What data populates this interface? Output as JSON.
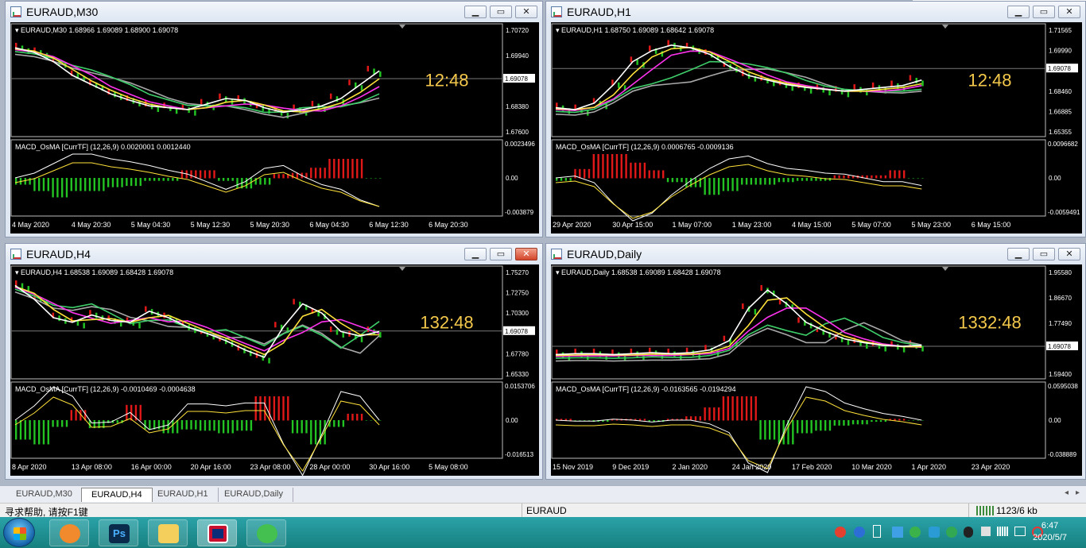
{
  "windows": [
    {
      "id": "w1",
      "title": "EURAUD,M30",
      "close_red": false,
      "info": "EURAUD,M30  1.68966 1.69089 1.68900 1.69078",
      "price_labels": [
        "1.70720",
        "1.69940",
        "1.69078",
        "1.68380",
        "1.67600"
      ],
      "price_marker": "1.69078",
      "timer": "12:48",
      "macd_label": "MACD_OsMA [CurrTF] (12,26,9) 0.0020001 0.0012440",
      "macd_labels": [
        "0.0023496",
        "0.00",
        "-0.003879"
      ],
      "time_labels": [
        "4 May 2020",
        "4 May 20:30",
        "5 May 04:30",
        "5 May 12:30",
        "5 May 20:30",
        "6 May 04:30",
        "6 May 12:30",
        "6 May 20:30"
      ]
    },
    {
      "id": "w2",
      "title": "EURAUD,H1",
      "close_red": false,
      "info": "EURAUD,H1  1.68750 1.69089 1.68642 1.69078",
      "price_labels": [
        "1.71565",
        "1.69990",
        "1.69078",
        "1.68460",
        "1.66885",
        "1.65355"
      ],
      "price_marker": "1.69078",
      "timer": "12:48",
      "macd_label": "MACD_OsMA [CurrTF] (12,26,9) 0.0006765 -0.0009136",
      "macd_labels": [
        "0.0096682",
        "0.00",
        "-0.0059491"
      ],
      "time_labels": [
        "29 Apr 2020",
        "30 Apr 15:00",
        "1 May 07:00",
        "1 May 23:00",
        "4 May 15:00",
        "5 May 07:00",
        "5 May 23:00",
        "6 May 15:00"
      ]
    },
    {
      "id": "w3",
      "title": "EURAUD,H4",
      "close_red": true,
      "info": "EURAUD,H4  1.68538 1.69089 1.68428 1.69078",
      "price_labels": [
        "1.75270",
        "1.72750",
        "1.70300",
        "1.69078",
        "1.67780",
        "1.65330"
      ],
      "price_marker": "1.69078",
      "timer": "132:48",
      "macd_label": "MACD_OsMA [CurrTF] (12,26,9) -0.0010469 -0.0004638",
      "macd_labels": [
        "0.0153706",
        "0.00",
        "-0.016513"
      ],
      "time_labels": [
        "8 Apr 2020",
        "13 Apr 08:00",
        "16 Apr 00:00",
        "20 Apr 16:00",
        "23 Apr 08:00",
        "28 Apr 00:00",
        "30 Apr 16:00",
        "5 May 08:00"
      ]
    },
    {
      "id": "w4",
      "title": "EURAUD,Daily",
      "close_red": false,
      "info": "EURAUD,Daily  1.68538 1.69089 1.68428 1.69078",
      "price_labels": [
        "1.95580",
        "1.86670",
        "1.77490",
        "1.69078",
        "1.59400"
      ],
      "price_marker": "1.69078",
      "timer": "1332:48",
      "macd_label": "MACD_OsMA [CurrTF] (12,26,9) -0.0163565 -0.0194294",
      "macd_labels": [
        "0.0595038",
        "0.00",
        "-0.038889"
      ],
      "time_labels": [
        "15 Nov 2019",
        "9 Dec 2019",
        "2 Jan 2020",
        "24 Jan 2020",
        "17 Feb 2020",
        "10 Mar 2020",
        "1 Apr 2020",
        "23 Apr 2020"
      ]
    }
  ],
  "tabs": [
    "EURAUD,M30",
    "EURAUD,H4",
    "EURAUD,H1",
    "EURAUD,Daily"
  ],
  "active_tab": 1,
  "status": {
    "help": "寻求帮助, 请按F1键",
    "symbol": "EURAUD",
    "traffic": "1123/6 kb"
  },
  "clock": {
    "time": "6:47",
    "date": "2020/5/7"
  },
  "colors": {
    "bull": "#22c322",
    "bear": "#e01818",
    "ma_fast": "#ffffff",
    "ma_yellow": "#ffe23a",
    "ma_magenta": "#ff33ee",
    "ma_green": "#3fcf6a",
    "ma_gray": "#a8a8a8",
    "timer": "#f4c84b"
  }
}
